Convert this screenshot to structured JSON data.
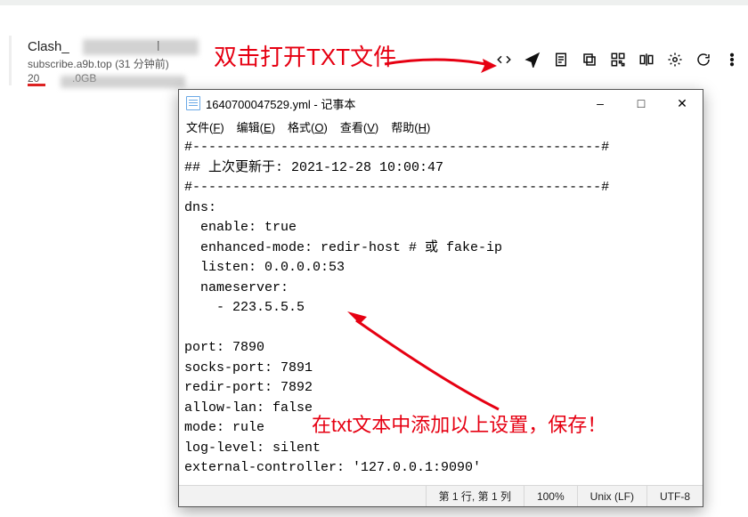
{
  "profile": {
    "title": "Clash_",
    "title_tail": "l",
    "sub": "subscribe.a9b.top (31 分钟前)",
    "row3_left": "20",
    "row3_right": ".0GB"
  },
  "annotations": {
    "a1": "双击打开TXT文件",
    "a2": "在txt文本中添加以上设置，保存！"
  },
  "toolbar_icons": [
    "code-icon",
    "send-icon",
    "file-icon",
    "copy-icon",
    "qr-icon",
    "mirror-icon",
    "gear-icon",
    "refresh-icon",
    "more-icon"
  ],
  "notepad": {
    "title": "1640700047529.yml - 记事本",
    "menu": {
      "file": {
        "label": "文件",
        "key": "F"
      },
      "edit": {
        "label": "编辑",
        "key": "E"
      },
      "format": {
        "label": "格式",
        "key": "O"
      },
      "view": {
        "label": "查看",
        "key": "V"
      },
      "help": {
        "label": "帮助",
        "key": "H"
      }
    },
    "body_lines": [
      "#---------------------------------------------------#",
      "## 上次更新于: 2021-12-28 10:00:47",
      "#---------------------------------------------------#",
      "dns:",
      "  enable: true",
      "  enhanced-mode: redir-host # 或 fake-ip",
      "  listen: 0.0.0.0:53",
      "  nameserver:",
      "    - 223.5.5.5",
      "",
      "port: 7890",
      "socks-port: 7891",
      "redir-port: 7892",
      "allow-lan: false",
      "mode: rule",
      "log-level: silent",
      "external-controller: '127.0.0.1:9090'"
    ],
    "status": {
      "pos": "第 1 行, 第 1 列",
      "zoom": "100%",
      "eol": "Unix (LF)",
      "enc": "UTF-8"
    }
  }
}
